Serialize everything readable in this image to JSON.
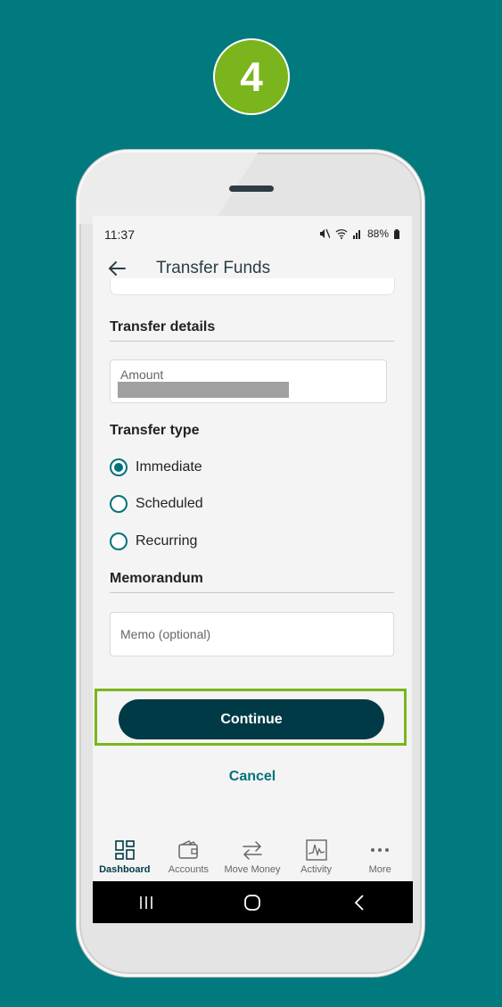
{
  "step": {
    "number": "4"
  },
  "status_bar": {
    "time": "11:37",
    "battery": "88%"
  },
  "header": {
    "title": "Transfer Funds"
  },
  "transfer_details": {
    "heading": "Transfer details",
    "amount_label": "Amount"
  },
  "transfer_type": {
    "heading": "Transfer type",
    "options": [
      {
        "label": "Immediate",
        "selected": true
      },
      {
        "label": "Scheduled",
        "selected": false
      },
      {
        "label": "Recurring",
        "selected": false
      }
    ]
  },
  "memorandum": {
    "heading": "Memorandum",
    "placeholder": "Memo (optional)"
  },
  "actions": {
    "continue_label": "Continue",
    "cancel_label": "Cancel"
  },
  "bottom_nav": {
    "items": [
      {
        "label": "Dashboard",
        "icon": "dashboard-icon",
        "active": true
      },
      {
        "label": "Accounts",
        "icon": "wallet-icon",
        "active": false
      },
      {
        "label": "Move Money",
        "icon": "transfer-arrows-icon",
        "active": false
      },
      {
        "label": "Activity",
        "icon": "activity-chart-icon",
        "active": false
      },
      {
        "label": "More",
        "icon": "more-dots-icon",
        "active": false
      }
    ]
  },
  "colors": {
    "background": "#007a7f",
    "step_badge": "#7ab51d",
    "primary_button": "#003a47",
    "accent": "#00727a",
    "highlight": "#7ab51d"
  }
}
